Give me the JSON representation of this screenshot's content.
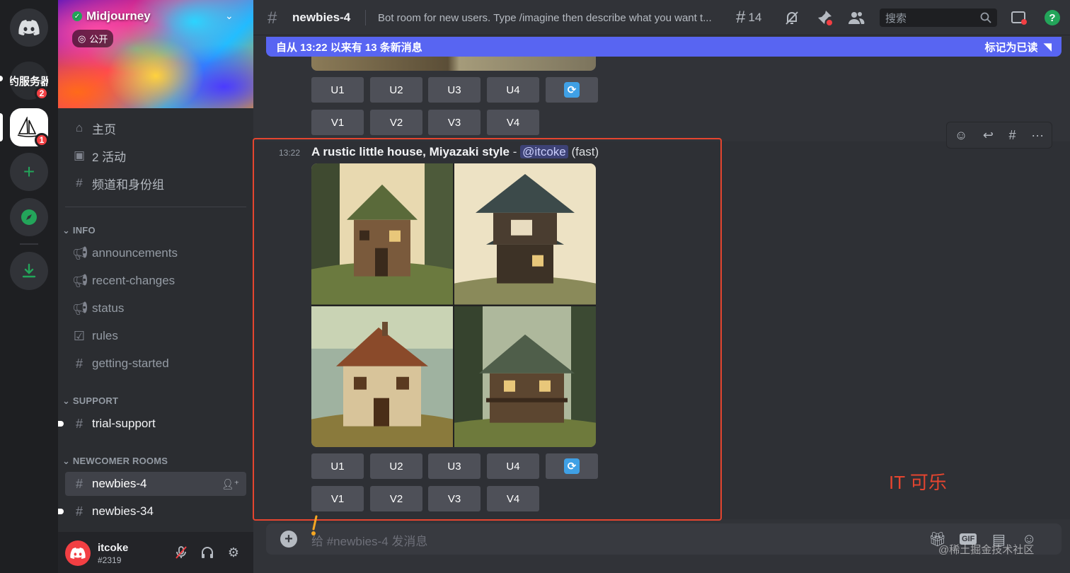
{
  "rail": {
    "server_text": "约服务器",
    "server_text_badge": "2",
    "midjourney_badge": "1"
  },
  "server": {
    "name": "Midjourney",
    "visibility": "公开"
  },
  "nav": {
    "home": "主页",
    "events": "2 活动",
    "channels_roles": "频道和身份组"
  },
  "categories": {
    "info": "INFO",
    "support": "SUPPORT",
    "newcomer": "NEWCOMER ROOMS"
  },
  "channels": {
    "info": [
      "announcements",
      "recent-changes",
      "status",
      "rules",
      "getting-started"
    ],
    "support": [
      "trial-support"
    ],
    "newcomer": [
      "newbies-4",
      "newbies-34"
    ]
  },
  "user": {
    "name": "itcoke",
    "tag": "#2319"
  },
  "header": {
    "channel": "newbies-4",
    "topic": "Bot room for new users. Type /imagine then describe what you want t...",
    "threads_count": "14",
    "search_placeholder": "搜索"
  },
  "new_messages_bar": {
    "text": "自从 13:22 以来有 13 条新消息",
    "mark_read": "标记为已读"
  },
  "buttons": {
    "u": [
      "U1",
      "U2",
      "U3",
      "U4"
    ],
    "v": [
      "V1",
      "V2",
      "V3",
      "V4"
    ]
  },
  "message": {
    "time": "13:22",
    "prompt": "A rustic little house, Miyazaki style",
    "dash": " - ",
    "mention": "@itcoke",
    "mode": " (fast)"
  },
  "overlay_text": "IT 可乐",
  "composer": {
    "placeholder": "给 #newbies-4 发消息",
    "gif": "GIF"
  },
  "watermark": "@稀土掘金技术社区",
  "colors": {
    "accent": "#5865f2",
    "highlight_box": "#e5452f",
    "badge": "#f23f43",
    "reroll": "#3fa0e5"
  }
}
